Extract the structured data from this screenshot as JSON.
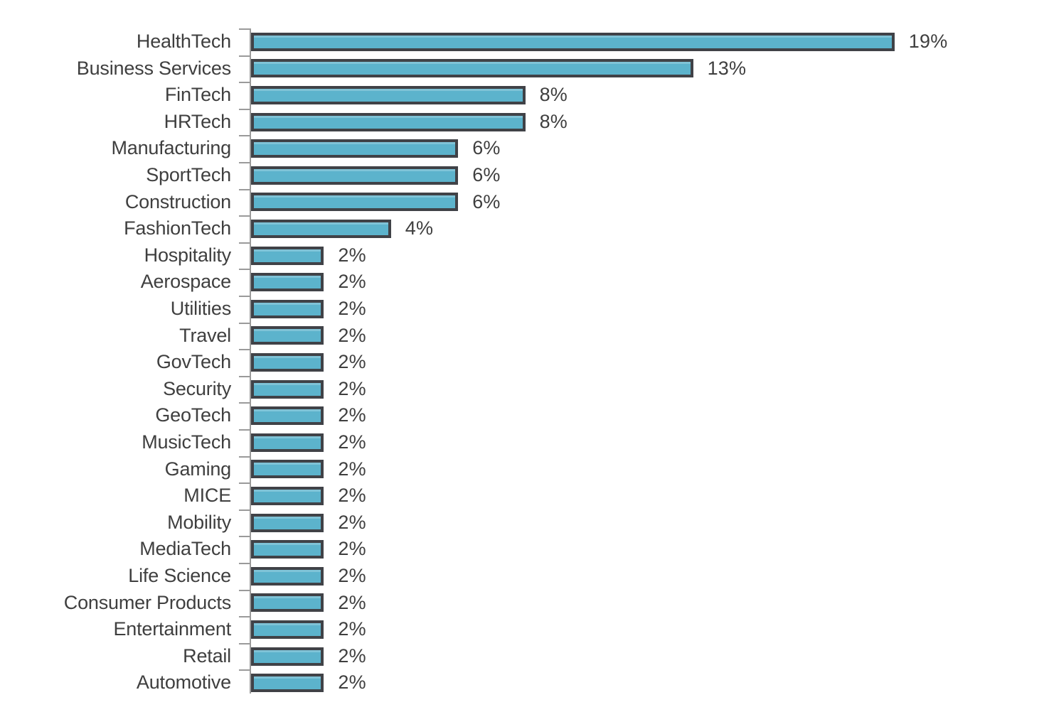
{
  "chart_data": {
    "type": "bar",
    "orientation": "horizontal",
    "title": "",
    "subtitle": "",
    "xlabel": "",
    "ylabel": "",
    "xlim": [
      0,
      19
    ],
    "grid": false,
    "legend": null,
    "value_suffix": "%",
    "categories": [
      "HealthTech",
      "Business Services",
      "FinTech",
      "HRTech",
      "Manufacturing",
      "SportTech",
      "Construction",
      "FashionTech",
      "Hospitality",
      "Aerospace",
      "Utilities",
      "Travel",
      "GovTech",
      "Security",
      "GeoTech",
      "MusicTech",
      "Gaming",
      "MICE",
      "Mobility",
      "MediaTech",
      "Life Science",
      "Consumer Products",
      "Entertainment",
      "Retail",
      "Automotive"
    ],
    "values": [
      19,
      13,
      8,
      8,
      6,
      6,
      6,
      4,
      2,
      2,
      2,
      2,
      2,
      2,
      2,
      2,
      2,
      2,
      2,
      2,
      2,
      2,
      2,
      2,
      2
    ],
    "value_labels": [
      "19%",
      "13%",
      "8%",
      "8%",
      "6%",
      "6%",
      "6%",
      "4%",
      "2%",
      "2%",
      "2%",
      "2%",
      "2%",
      "2%",
      "2%",
      "2%",
      "2%",
      "2%",
      "2%",
      "2%",
      "2%",
      "2%",
      "2%",
      "2%",
      "2%"
    ],
    "colors": {
      "bar_fill": "#5cb3cc",
      "bar_border": "#404247",
      "text": "#3f3f3f",
      "axis": "#9a9a9a",
      "background": "#ffffff"
    }
  }
}
